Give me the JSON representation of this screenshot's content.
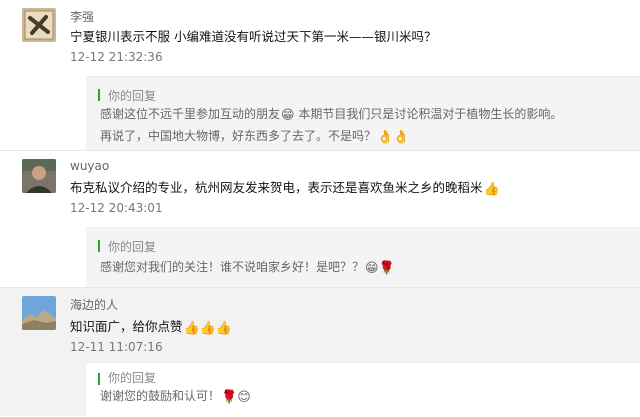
{
  "comments": [
    {
      "user": "李强",
      "text": "宁夏银川表示不服 小编难道没有听说过天下第一米——银川米吗？",
      "time": "12-12 21:32:36",
      "reply_title": "你的回复",
      "reply_line1": "感谢这位不远千里参加互动的朋友",
      "reply_line1_emoji": "😁",
      "reply_line1_rest": " 本期节目我们只是讨论积温对于植物生长的影响。",
      "reply_line2": "再说了，中国地大物博，好东西多了去了。不是吗？",
      "reply_line2_emoji": "👌👌"
    },
    {
      "user": "wuyao",
      "text": "布克私议介绍的专业，杭州网友发来贺电，表示还是喜欢鱼米之乡的晚稻米",
      "text_emoji": "👍",
      "time": "12-12 20:43:01",
      "reply_title": "你的回复",
      "reply_line1": "感谢您对我们的关注！谁不说咱家乡好！是吧？？",
      "reply_line1_emoji": "😁🌹"
    },
    {
      "user": "海边的人",
      "text": "知识面广，给你点赞",
      "text_emoji": "👍👍👍",
      "time": "12-11 11:07:16",
      "reply_title": "你的回复",
      "reply_line1": "谢谢您的鼓励和认可！",
      "reply_line1_emoji": "🌹😊"
    }
  ]
}
